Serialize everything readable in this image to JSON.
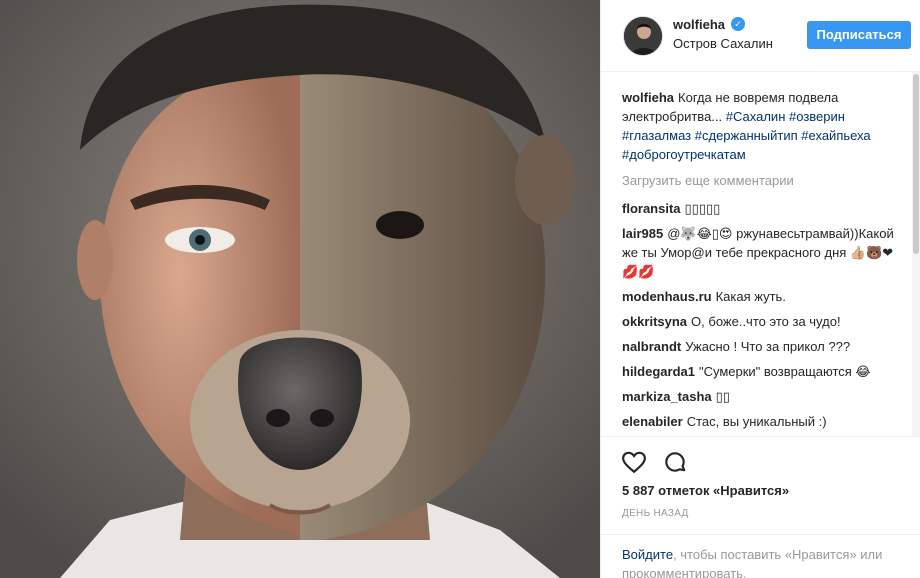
{
  "post": {
    "username": "wolfieha",
    "location": "Остров Сахалин",
    "follow_label": "Подписаться",
    "verified_icon": "verified-badge-icon"
  },
  "caption": {
    "user": "wolfieha",
    "text": "Когда не вовремя подвела электробритва...",
    "tags": [
      "#Сахалин",
      "#озверин",
      "#глазалмаз",
      "#сдержанныйтип",
      "#ехайпьеха",
      "#доброгоутречкатам"
    ]
  },
  "load_more_label": "Загрузить еще комментарии",
  "comments": [
    {
      "user": "floransita",
      "text": "▯▯▯▯▯"
    },
    {
      "user": "lair985",
      "text": "@🐺😂▯😍 ржунавесьтрамвай))Какой же ты Умор@и тебе прекрасного дня 👍🏼🐻❤💋💋"
    },
    {
      "user": "modenhaus.ru",
      "text": "Какая жуть."
    },
    {
      "user": "okkritsyna",
      "text": "О, боже..что это за чудо!"
    },
    {
      "user": "nalbrandt",
      "text": "Ужасно ! Что за прикол ???"
    },
    {
      "user": "hildegarda1",
      "text": "\"Сумерки\" возвращаются 😂"
    },
    {
      "user": "markiza_tasha",
      "text": "▯▯"
    },
    {
      "user": "elenabiler",
      "text": "Стас, вы уникальный :)"
    }
  ],
  "likes_text": "5 887 отметок «Нравится»",
  "time_text": "день назад",
  "login": {
    "link": "Войдите",
    "text": ", чтобы поставить «Нравится» или прокомментировать."
  },
  "colors": {
    "accent": "#3897f0",
    "link": "#003569",
    "muted": "#999999"
  }
}
